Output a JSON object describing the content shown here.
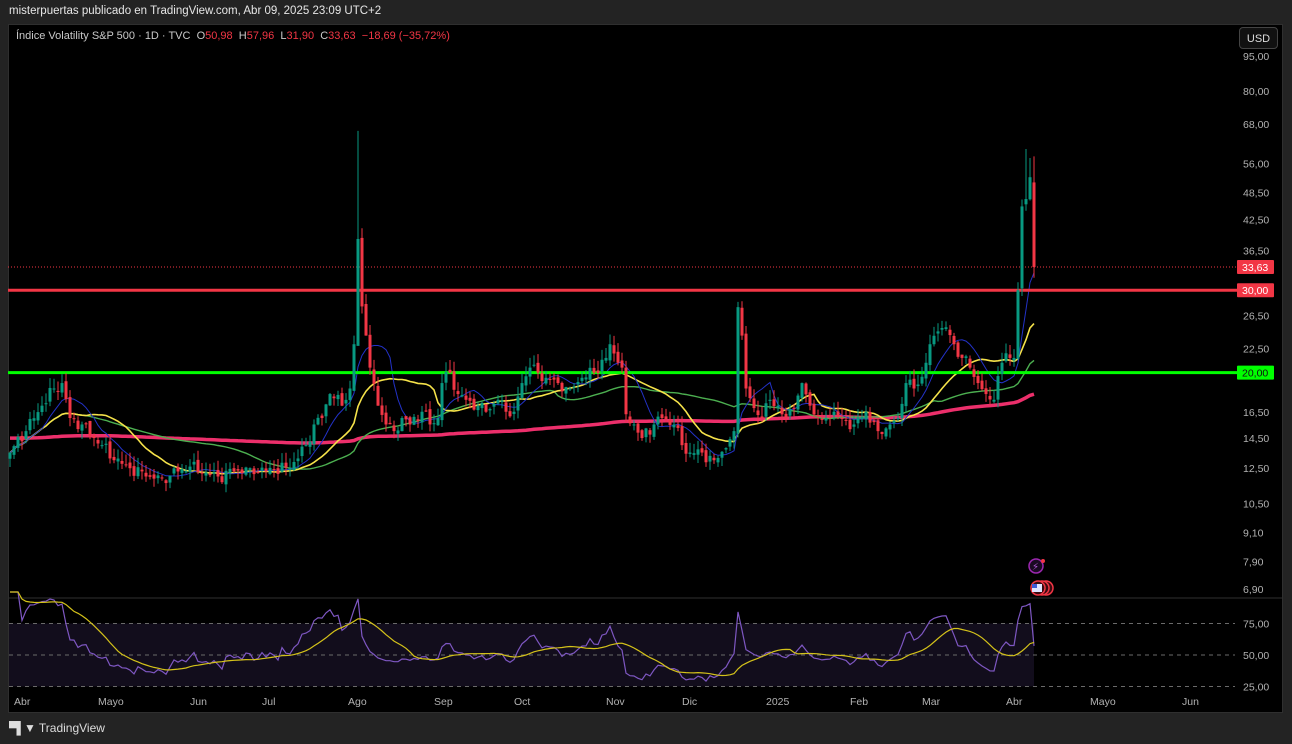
{
  "header": {
    "published": "misterpuertas publicado en TradingView.com, Abr 09, 2025 23:09 UTC+2"
  },
  "legend": {
    "symbol": "Índice Volatility S&P 500 · 1D · TVC",
    "o_label": "O",
    "o": "50,98",
    "h_label": "H",
    "h": "57,96",
    "l_label": "L",
    "l": "31,90",
    "c_label": "C",
    "c": "33,63",
    "change": "−18,69 (−35,72%)"
  },
  "currency_button": "USD",
  "footer": {
    "brand": "TradingView",
    "logo": "17"
  },
  "colors": {
    "up": "#089981",
    "down": "#f23645",
    "ma_fast": "#2332c8",
    "ma_mid": "#f5e24a",
    "ma_slow": "#4caf50",
    "ma_long": "#ec2f6b",
    "line_30": "#f23645",
    "line_20": "#00ff00",
    "rsi": "#7e57c2",
    "rsi_ma": "#d4c21a"
  },
  "chart_data": {
    "type": "candlestick",
    "title": "Índice Volatility S&P 500 · 1D · TVC",
    "scale": "log",
    "price_ticks": [
      "95,00",
      "80,00",
      "68,00",
      "56,00",
      "48,50",
      "42,50",
      "36,50",
      "26,50",
      "22,50",
      "16,50",
      "14,50",
      "12,50",
      "10,50",
      "9,10",
      "7,90",
      "6,90"
    ],
    "price_tick_values": [
      95,
      80,
      68,
      56,
      48.5,
      42.5,
      36.5,
      26.5,
      22.5,
      16.5,
      14.5,
      12.5,
      10.5,
      9.1,
      7.9,
      6.9
    ],
    "last_price": {
      "value": 33.63,
      "label": "33,63"
    },
    "horizontal_lines": [
      {
        "value": 30,
        "label": "30,00",
        "color": "#f23645"
      },
      {
        "value": 20,
        "label": "20,00",
        "color": "#00ff00"
      }
    ],
    "time_labels": [
      {
        "label": "Abr",
        "day": 2
      },
      {
        "label": "Mayo",
        "day": 23
      },
      {
        "label": "Jun",
        "day": 46
      },
      {
        "label": "Jul",
        "day": 64
      },
      {
        "label": "Ago",
        "day": 85.5
      },
      {
        "label": "Sep",
        "day": 107
      },
      {
        "label": "Oct",
        "day": 127
      },
      {
        "label": "Nov",
        "day": 150
      },
      {
        "label": "Dic",
        "day": 169
      },
      {
        "label": "2025",
        "day": 190
      },
      {
        "label": "Feb",
        "day": 211
      },
      {
        "label": "Mar",
        "day": 229
      },
      {
        "label": "Abr",
        "day": 250
      },
      {
        "label": "Mayo",
        "day": 271
      },
      {
        "label": "Jun",
        "day": 294
      }
    ],
    "close_anchors": [
      [
        0,
        13.5
      ],
      [
        4,
        15
      ],
      [
        8,
        17
      ],
      [
        11,
        18.5
      ],
      [
        13,
        19
      ],
      [
        15,
        16
      ],
      [
        18,
        15.5
      ],
      [
        21,
        14.5
      ],
      [
        23,
        14
      ],
      [
        26,
        13
      ],
      [
        30,
        12.5
      ],
      [
        34,
        12
      ],
      [
        38,
        11.9
      ],
      [
        42,
        12.3
      ],
      [
        45,
        12.6
      ],
      [
        48,
        12.2
      ],
      [
        52,
        12
      ],
      [
        56,
        12.3
      ],
      [
        60,
        12.5
      ],
      [
        64,
        12.3
      ],
      [
        66,
        12.4
      ],
      [
        70,
        12.5
      ],
      [
        74,
        14
      ],
      [
        76,
        15.5
      ],
      [
        78,
        16
      ],
      [
        80,
        18
      ],
      [
        83,
        17
      ],
      [
        85,
        18.5
      ],
      [
        86,
        23
      ],
      [
        87,
        38.6
      ],
      [
        88,
        27.7
      ],
      [
        89,
        24
      ],
      [
        90,
        20.5
      ],
      [
        92,
        17
      ],
      [
        94,
        15.5
      ],
      [
        96,
        15
      ],
      [
        98,
        16
      ],
      [
        100,
        15.5
      ],
      [
        103,
        16.5
      ],
      [
        105,
        15.5
      ],
      [
        107,
        16
      ],
      [
        108,
        19
      ],
      [
        110,
        20
      ],
      [
        112,
        18
      ],
      [
        114,
        17.5
      ],
      [
        117,
        17
      ],
      [
        119,
        16.5
      ],
      [
        122,
        17.5
      ],
      [
        124,
        16.5
      ],
      [
        126,
        16.5
      ],
      [
        128,
        19
      ],
      [
        130,
        20.5
      ],
      [
        132,
        20
      ],
      [
        134,
        19.5
      ],
      [
        137,
        19
      ],
      [
        140,
        18.5
      ],
      [
        143,
        19.5
      ],
      [
        146,
        20
      ],
      [
        149,
        21.5
      ],
      [
        150,
        23
      ],
      [
        152,
        21
      ],
      [
        153,
        20.5
      ],
      [
        154,
        16.3
      ],
      [
        156,
        15.5
      ],
      [
        158,
        14.5
      ],
      [
        161,
        15.5
      ],
      [
        163,
        16
      ],
      [
        166,
        15.5
      ],
      [
        168,
        14
      ],
      [
        170,
        13.5
      ],
      [
        173,
        13.5
      ],
      [
        176,
        13
      ],
      [
        179,
        13.8
      ],
      [
        181,
        15
      ],
      [
        182,
        27.6
      ],
      [
        183,
        24
      ],
      [
        184,
        18.5
      ],
      [
        186,
        16.8
      ],
      [
        188,
        16
      ],
      [
        190,
        17.5
      ],
      [
        192,
        17
      ],
      [
        194,
        16
      ],
      [
        196,
        16.8
      ],
      [
        198,
        19
      ],
      [
        200,
        17
      ],
      [
        203,
        15.9
      ],
      [
        206,
        16.5
      ],
      [
        208,
        16
      ],
      [
        211,
        15.5
      ],
      [
        214,
        16.5
      ],
      [
        217,
        15
      ],
      [
        220,
        15.5
      ],
      [
        222,
        16
      ],
      [
        224,
        19
      ],
      [
        226,
        18.5
      ],
      [
        228,
        19.6
      ],
      [
        230,
        23
      ],
      [
        232,
        24.5
      ],
      [
        234,
        25
      ],
      [
        236,
        23
      ],
      [
        238,
        21.5
      ],
      [
        240,
        20.5
      ],
      [
        242,
        19
      ],
      [
        244,
        18
      ],
      [
        246,
        17.5
      ],
      [
        248,
        21
      ],
      [
        249,
        22
      ],
      [
        250,
        21.5
      ],
      [
        251,
        21.5
      ],
      [
        252,
        30
      ],
      [
        253,
        45.3
      ],
      [
        254,
        46.98
      ],
      [
        255,
        52.3
      ],
      [
        256,
        33.63
      ]
    ],
    "high_overrides": {
      "87": 65.7,
      "254": 60.1,
      "255": 57.5,
      "256": 57.96
    },
    "low_overrides": {
      "256": 31.9,
      "87": 23
    },
    "open_overrides": {
      "256": 50.98
    },
    "moving_averages": [
      {
        "name": "MA fast",
        "period": 9
      },
      {
        "name": "MA mid",
        "period": 20
      },
      {
        "name": "MA slow",
        "period": 50
      },
      {
        "name": "MA long",
        "period": 200,
        "seed": 14.5
      }
    ],
    "rsi": {
      "period": 14,
      "signal": 14,
      "ticks": [
        "75,00",
        "50,00",
        "25,00"
      ],
      "tick_values": [
        75,
        50,
        25
      ]
    }
  }
}
